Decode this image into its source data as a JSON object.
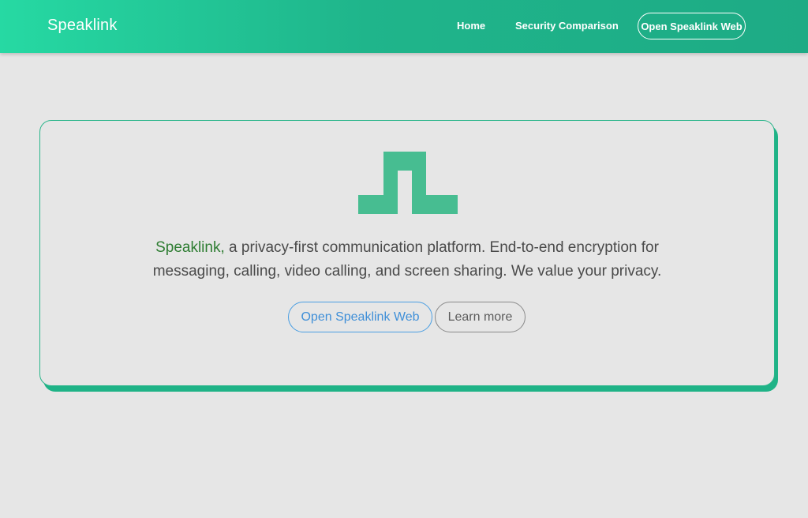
{
  "navbar": {
    "brand": "Speaklink",
    "links": [
      {
        "label": "Home"
      },
      {
        "label": "Security Comparison"
      }
    ],
    "cta_label": "Open Speaklink Web"
  },
  "hero": {
    "logo_icon": "speaklink-sl-logo-icon",
    "logo_color": "#47bd91",
    "brand_word": "Speaklink,",
    "tagline_line1": " a privacy-first communication platform. End-to-end encryption for",
    "tagline_line2": "messaging, calling, video calling, and screen sharing. We value your privacy.",
    "buttons": {
      "primary_label": "Open Speaklink Web",
      "secondary_label": "Learn more"
    }
  },
  "colors": {
    "accent": "#1fb58b",
    "accent_light": "#26d9a3",
    "background": "#e6e6e6",
    "brand_word": "#2e7d32",
    "primary_button": "#3f8fd8"
  }
}
